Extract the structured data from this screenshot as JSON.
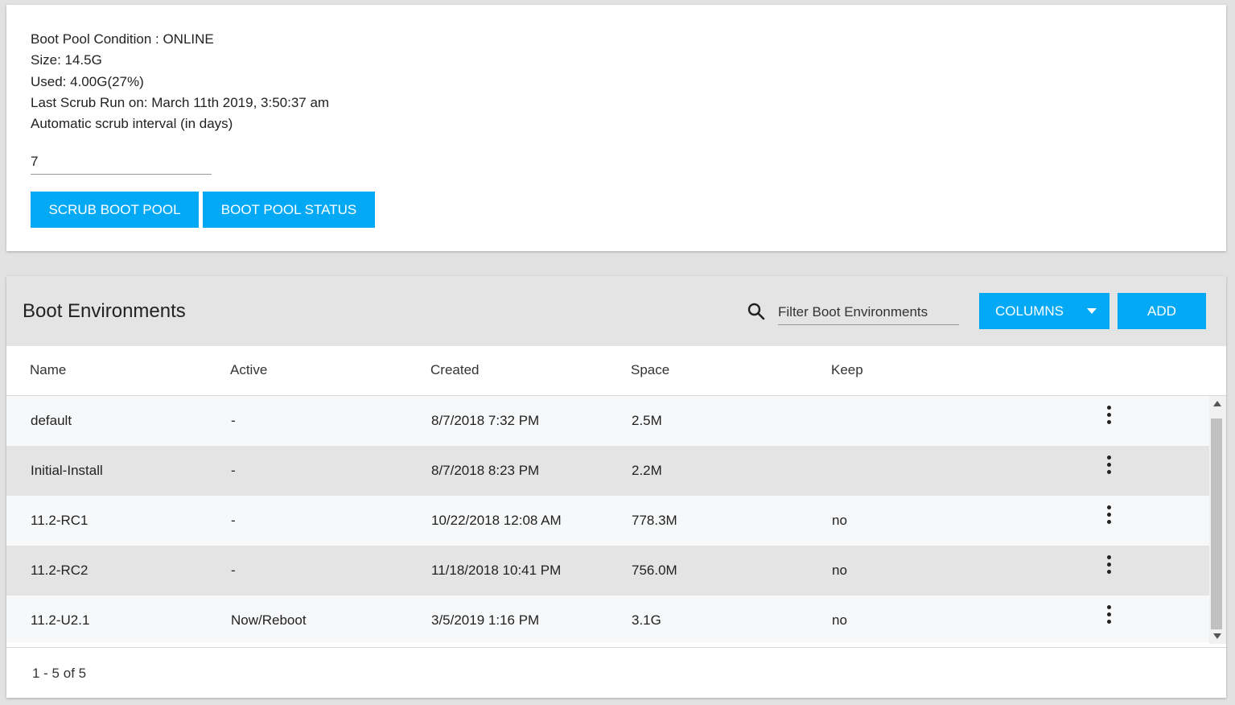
{
  "boot_pool": {
    "condition": "Boot Pool Condition : ONLINE",
    "size": "Size: 14.5G",
    "used": "Used: 4.00G(27%)",
    "last_scrub": "Last Scrub Run on: March 11th 2019, 3:50:37 am",
    "scrub_interval_label": "Automatic scrub interval (in days)",
    "scrub_interval_value": "7",
    "scrub_button": "SCRUB BOOT POOL",
    "status_button": "BOOT POOL STATUS"
  },
  "environments": {
    "title": "Boot Environments",
    "filter_placeholder": "Filter Boot Environments",
    "columns_button": "COLUMNS",
    "add_button": "ADD",
    "headers": [
      "Name",
      "Active",
      "Created",
      "Space",
      "Keep"
    ],
    "rows": [
      {
        "name": "default",
        "active": "-",
        "created": "8/7/2018 7:32 PM",
        "space": "2.5M",
        "keep": ""
      },
      {
        "name": "Initial-Install",
        "active": "-",
        "created": "8/7/2018 8:23 PM",
        "space": "2.2M",
        "keep": ""
      },
      {
        "name": "11.2-RC1",
        "active": "-",
        "created": "10/22/2018 12:08 AM",
        "space": "778.3M",
        "keep": "no"
      },
      {
        "name": "11.2-RC2",
        "active": "-",
        "created": "11/18/2018 10:41 PM",
        "space": "756.0M",
        "keep": "no"
      },
      {
        "name": "11.2-U2.1",
        "active": "Now/Reboot",
        "created": "3/5/2019 1:16 PM",
        "space": "3.1G",
        "keep": "no"
      }
    ],
    "pagination": "1 - 5 of 5"
  },
  "colors": {
    "accent": "#03a9f4",
    "header_bg": "#e4e4e4",
    "page_bg": "#e2e2e2"
  },
  "icons": {
    "search": "search-icon",
    "row_menu": "more-vert-icon",
    "dropdown": "caret-down-icon"
  }
}
